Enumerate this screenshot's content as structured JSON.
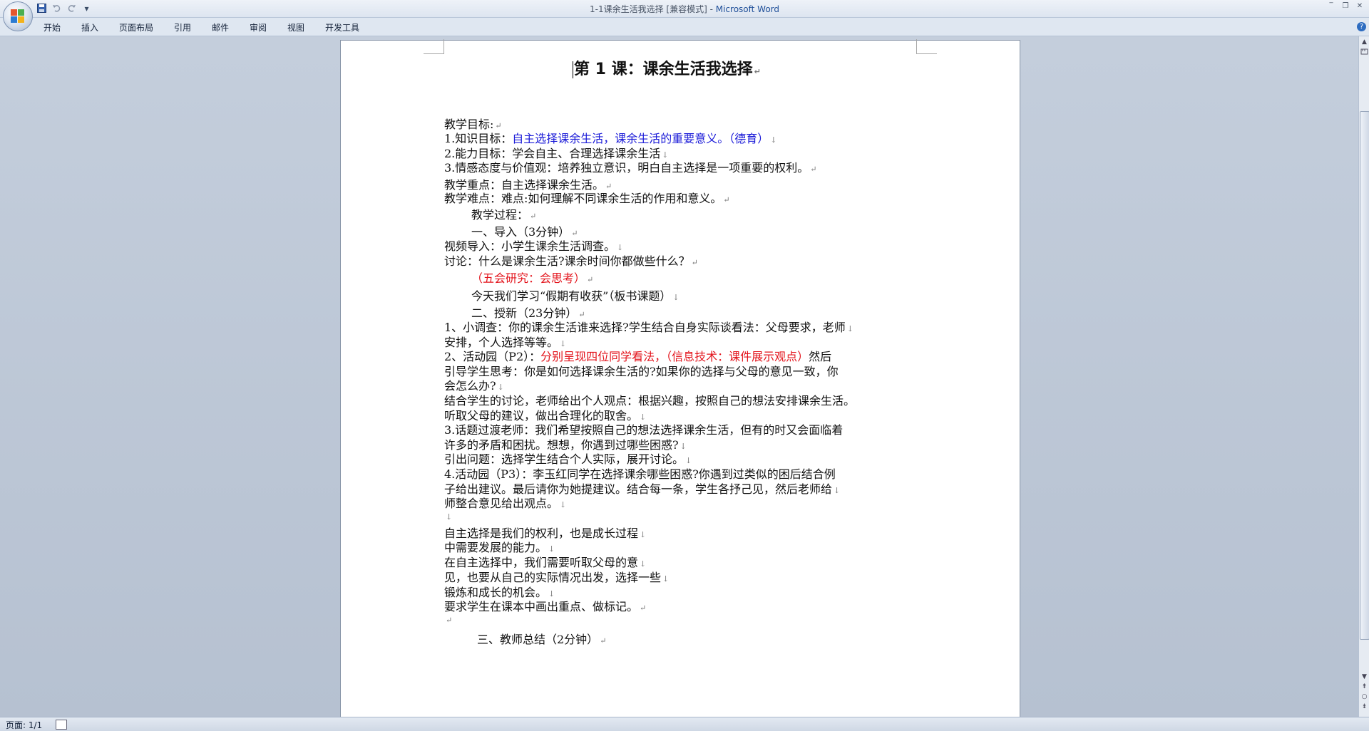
{
  "window": {
    "doc_title": "1-1课余生活我选择 [兼容模式]",
    "separator": " - ",
    "app_name": "Microsoft Word",
    "controls": [
      "‾",
      "❐",
      "✕"
    ]
  },
  "quick_access": {
    "dropdown": "▾"
  },
  "ribbon": {
    "tabs": [
      "开始",
      "插入",
      "页面布局",
      "引用",
      "邮件",
      "审阅",
      "视图",
      "开发工具"
    ],
    "help": "?"
  },
  "document": {
    "title": "第 1 课：课余生活我选择",
    "lines": [
      {
        "segments": [
          {
            "text": "教学目标:",
            "color": "black"
          }
        ],
        "mark": "↵"
      },
      {
        "segments": [
          {
            "text": "1.知识目标：",
            "color": "black"
          },
          {
            "text": "自主选择课余生活，课余生活的重要意义。（德育）",
            "color": "blue"
          }
        ],
        "mark": "↓"
      },
      {
        "segments": [
          {
            "text": "2.能力目标：学会自主、合理选择课余生活",
            "color": "black"
          }
        ],
        "mark": "↓"
      },
      {
        "segments": [
          {
            "text": "3.情感态度与价值观：培养独立意识，明白自主选择是一项重要的权利。",
            "color": "black"
          }
        ],
        "mark": "↵"
      },
      {
        "segments": [
          {
            "text": "教学重点：自主选择课余生活。",
            "color": "black"
          }
        ],
        "mark": "↵"
      },
      {
        "segments": [
          {
            "text": "教学难点：难点:如何理解不同课余生活的作用和意义。",
            "color": "black"
          }
        ],
        "mark": "↵"
      },
      {
        "segments": [
          {
            "text": "教学过程：",
            "color": "black"
          }
        ],
        "mark": "↵"
      },
      {
        "segments": [
          {
            "text": "一、导入（3分钟）",
            "color": "black"
          }
        ],
        "mark": "↵"
      },
      {
        "segments": [
          {
            "text": "视频导入：小学生课余生活调查。",
            "color": "black"
          }
        ],
        "mark": "↓"
      },
      {
        "segments": [
          {
            "text": "讨论：什么是课余生活?课余时间你都做些什么？",
            "color": "black"
          }
        ],
        "mark": "↵"
      },
      {
        "segments": [
          {
            "text": "（五会研究：会思考）",
            "color": "red"
          }
        ],
        "mark": "↵"
      },
      {
        "segments": [
          {
            "text": "今天我们学习“假期有收获”（板书课题）",
            "color": "black"
          }
        ],
        "mark": "↓"
      },
      {
        "segments": [
          {
            "text": "二、授新（23分钟）",
            "color": "black"
          }
        ],
        "mark": "↵"
      },
      {
        "segments": [
          {
            "text": "1、小调查：你的课余生活谁来选择?学生结合自身实际谈看法：父母要求，老师",
            "color": "black"
          }
        ],
        "mark": "↓"
      },
      {
        "segments": [
          {
            "text": "安排，个人选择等等。",
            "color": "black"
          }
        ],
        "mark": "↓"
      },
      {
        "segments": [
          {
            "text": "2、活动园（P2）：",
            "color": "black"
          },
          {
            "text": "分别呈现四位同学看法，（信息技术：课件展示观点）",
            "color": "red"
          },
          {
            "text": "然后",
            "color": "black"
          }
        ],
        "mark": ""
      },
      {
        "segments": [
          {
            "text": "引导学生思考：你是如何选择课余生活的?如果你的选择与父母的意见一致，你",
            "color": "black"
          }
        ],
        "mark": ""
      },
      {
        "segments": [
          {
            "text": "会怎么办?",
            "color": "black"
          }
        ],
        "mark": "↓"
      },
      {
        "segments": [
          {
            "text": "结合学生的讨论，老师给出个人观点：根据兴趣，按照自己的想法安排课余生活。",
            "color": "black"
          }
        ],
        "mark": ""
      },
      {
        "segments": [
          {
            "text": "听取父母的建议，做出合理化的取舍。",
            "color": "black"
          }
        ],
        "mark": "↓"
      },
      {
        "segments": [
          {
            "text": "3.话题过渡老师：我们希望按照自己的想法选择课余生活，但有的时又会面临着",
            "color": "black"
          }
        ],
        "mark": ""
      },
      {
        "segments": [
          {
            "text": "许多的矛盾和困扰。想想，你遇到过哪些困惑?",
            "color": "black"
          }
        ],
        "mark": "↓"
      },
      {
        "segments": [
          {
            "text": "引出问题：选择学生结合个人实际，展开讨论。",
            "color": "black"
          }
        ],
        "mark": "↓"
      },
      {
        "segments": [
          {
            "text": "4.活动园（P3）：李玉红同学在选择课余哪些困惑?你遇到过类似的困后结合例",
            "color": "black"
          }
        ],
        "mark": ""
      },
      {
        "segments": [
          {
            "text": "子给出建议。最后请你为她提建议。结合每一条，学生各抒己见，然后老师给",
            "color": "black"
          }
        ],
        "mark": "↓"
      },
      {
        "segments": [
          {
            "text": "师整合意见给出观点。",
            "color": "black"
          }
        ],
        "mark": "↓"
      },
      {
        "segments": [],
        "mark": "↓"
      },
      {
        "segments": [
          {
            "text": "自主选择是我们的权利，也是成长过程",
            "color": "black"
          }
        ],
        "mark": "↓"
      },
      {
        "segments": [
          {
            "text": "中需要发展的能力。",
            "color": "black"
          }
        ],
        "mark": "↓"
      },
      {
        "segments": [
          {
            "text": "在自主选择中，我们需要听取父母的意",
            "color": "black"
          }
        ],
        "mark": "↓"
      },
      {
        "segments": [
          {
            "text": "见，也要从自己的实际情况出发，选择一些",
            "color": "black"
          }
        ],
        "mark": "↓"
      },
      {
        "segments": [
          {
            "text": "锻炼和成长的机会。",
            "color": "black"
          }
        ],
        "mark": "↓"
      },
      {
        "segments": [
          {
            "text": "要求学生在课本中画出重点、做标记。",
            "color": "black"
          }
        ],
        "mark": "↵"
      },
      {
        "segments": [],
        "mark": "↵"
      },
      {
        "segments": [
          {
            "text": "三、教师总结（2分钟）",
            "color": "black"
          }
        ],
        "mark": "↵"
      }
    ]
  },
  "scrollbar": {
    "up": "▲",
    "down": "▼",
    "prev": "⇞",
    "select": "○",
    "next": "⇟"
  },
  "status": {
    "page": "页面: 1/1"
  },
  "colors": {
    "blue": "#1a1ad8",
    "red": "#e3131b",
    "black": "#111111"
  }
}
